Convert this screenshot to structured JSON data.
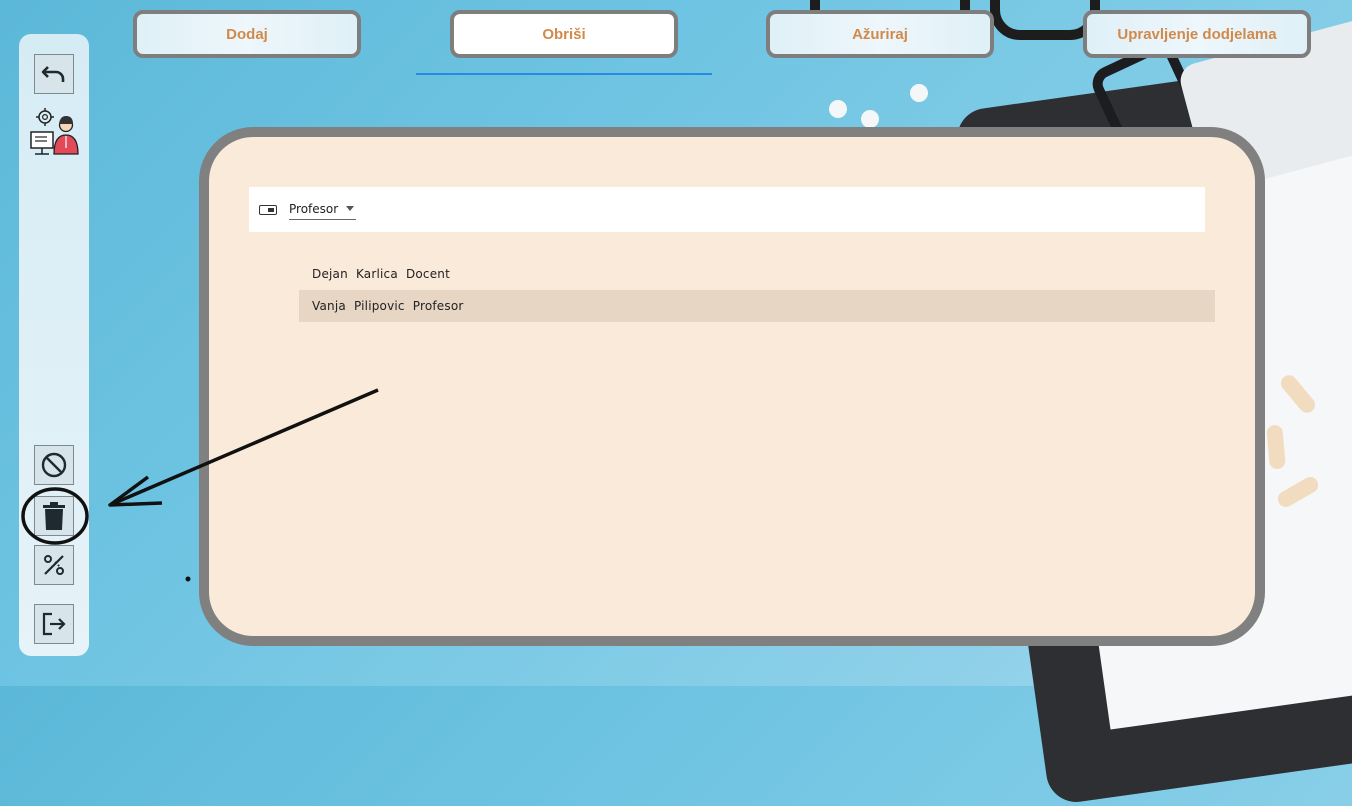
{
  "nav": {
    "tabs": [
      {
        "label": "Dodaj"
      },
      {
        "label": "Obriši"
      },
      {
        "label": "Ažuriraj"
      },
      {
        "label": "Upravljenje dodjelama"
      }
    ]
  },
  "sidebar": {
    "icons": [
      "undo-icon",
      "admin-icon",
      "ban-icon",
      "trash-icon",
      "percent-icon",
      "logout-icon"
    ]
  },
  "filter": {
    "selected": "Profesor"
  },
  "list": {
    "items": [
      {
        "text": "Dejan  Karlica  Docent"
      },
      {
        "text": "Vanja  Pilipovic  Profesor"
      }
    ]
  },
  "colors": {
    "tab_text": "#d18a4b",
    "card_bg": "#faeada",
    "card_border": "#808080",
    "selected_row": "#e6d6c3",
    "active_underline": "#2a8ae0"
  }
}
